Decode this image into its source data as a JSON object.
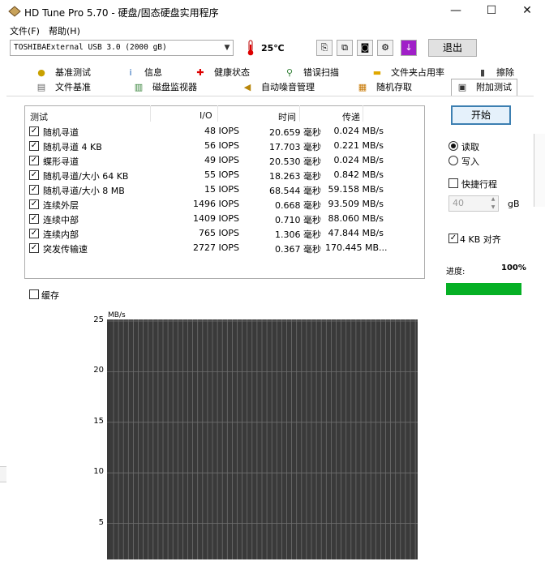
{
  "window": {
    "title": "HD Tune Pro 5.70 - 硬盘/固态硬盘实用程序",
    "controls": [
      "—",
      "☐",
      "✕"
    ]
  },
  "menu": [
    "文件(F)",
    "帮助(H)"
  ],
  "toolbar": {
    "drive": "TOSHIBAExternal USB 3.0 (2000 gB)",
    "temperature": "25℃",
    "exit_label": "退出"
  },
  "tabs_row1": [
    {
      "label": "基准测试",
      "icon": "benchmark-icon"
    },
    {
      "label": "信息",
      "icon": "info-icon"
    },
    {
      "label": "健康状态",
      "icon": "health-icon"
    },
    {
      "label": "错误扫描",
      "icon": "scan-icon"
    },
    {
      "label": "文件夹占用率",
      "icon": "folder-icon"
    },
    {
      "label": "擦除",
      "icon": "erase-icon"
    }
  ],
  "tabs_row2": [
    {
      "label": "文件基准",
      "icon": "file-icon"
    },
    {
      "label": "磁盘监视器",
      "icon": "monitor-icon"
    },
    {
      "label": "自动噪音管理",
      "icon": "speaker-icon"
    },
    {
      "label": "随机存取",
      "icon": "random-icon"
    },
    {
      "label": "附加测试",
      "icon": "extra-icon"
    }
  ],
  "results": {
    "headers": [
      "测试",
      "I/O",
      "时间",
      "传递"
    ],
    "rows": [
      {
        "checked": true,
        "name": "随机寻道",
        "io": "48 IOPS",
        "time": "20.659 毫秒",
        "rate": "0.024 MB/s"
      },
      {
        "checked": true,
        "name": "随机寻道 4 KB",
        "io": "56 IOPS",
        "time": "17.703 毫秒",
        "rate": "0.221 MB/s"
      },
      {
        "checked": true,
        "name": "蝶形寻道",
        "io": "49 IOPS",
        "time": "20.530 毫秒",
        "rate": "0.024 MB/s"
      },
      {
        "checked": true,
        "name": "随机寻道/大小 64 KB",
        "io": "55 IOPS",
        "time": "18.263 毫秒",
        "rate": "0.842 MB/s"
      },
      {
        "checked": true,
        "name": "随机寻道/大小 8 MB",
        "io": "15 IOPS",
        "time": "68.544 毫秒",
        "rate": "59.158 MB/s"
      },
      {
        "checked": true,
        "name": "连续外层",
        "io": "1496 IOPS",
        "time": "0.668 毫秒",
        "rate": "93.509 MB/s"
      },
      {
        "checked": true,
        "name": "连续中部",
        "io": "1409 IOPS",
        "time": "0.710 毫秒",
        "rate": "88.060 MB/s"
      },
      {
        "checked": true,
        "name": "连续内部",
        "io": "765 IOPS",
        "time": "1.306 毫秒",
        "rate": "47.844 MB/s"
      },
      {
        "checked": true,
        "name": "突发传输速",
        "io": "2727 IOPS",
        "time": "0.367 毫秒",
        "rate": "170.445 MB..."
      }
    ]
  },
  "controls": {
    "start_label": "开始",
    "read_label": "读取",
    "write_label": "写入",
    "mode": "read",
    "short_stroke_label": "快捷行程",
    "short_stroke_checked": false,
    "stroke_value": "40",
    "stroke_unit": "gB",
    "align_label": "4 KB 对齐",
    "align_checked": true,
    "progress_label": "进度:",
    "progress_text": "100%",
    "progress": 1.0,
    "cache_label": "缓存",
    "cache_checked": false
  },
  "chart_data": {
    "type": "bar",
    "ylabel": "MB/s",
    "yticks": [
      25,
      20,
      15,
      10,
      5
    ],
    "ylim": [
      0,
      25
    ],
    "grid": true
  },
  "colors": {
    "accent": "#3c7fb1",
    "progress": "#06b025",
    "chart_bg": "#3a3a3a",
    "grid": "#6e6e6e"
  }
}
